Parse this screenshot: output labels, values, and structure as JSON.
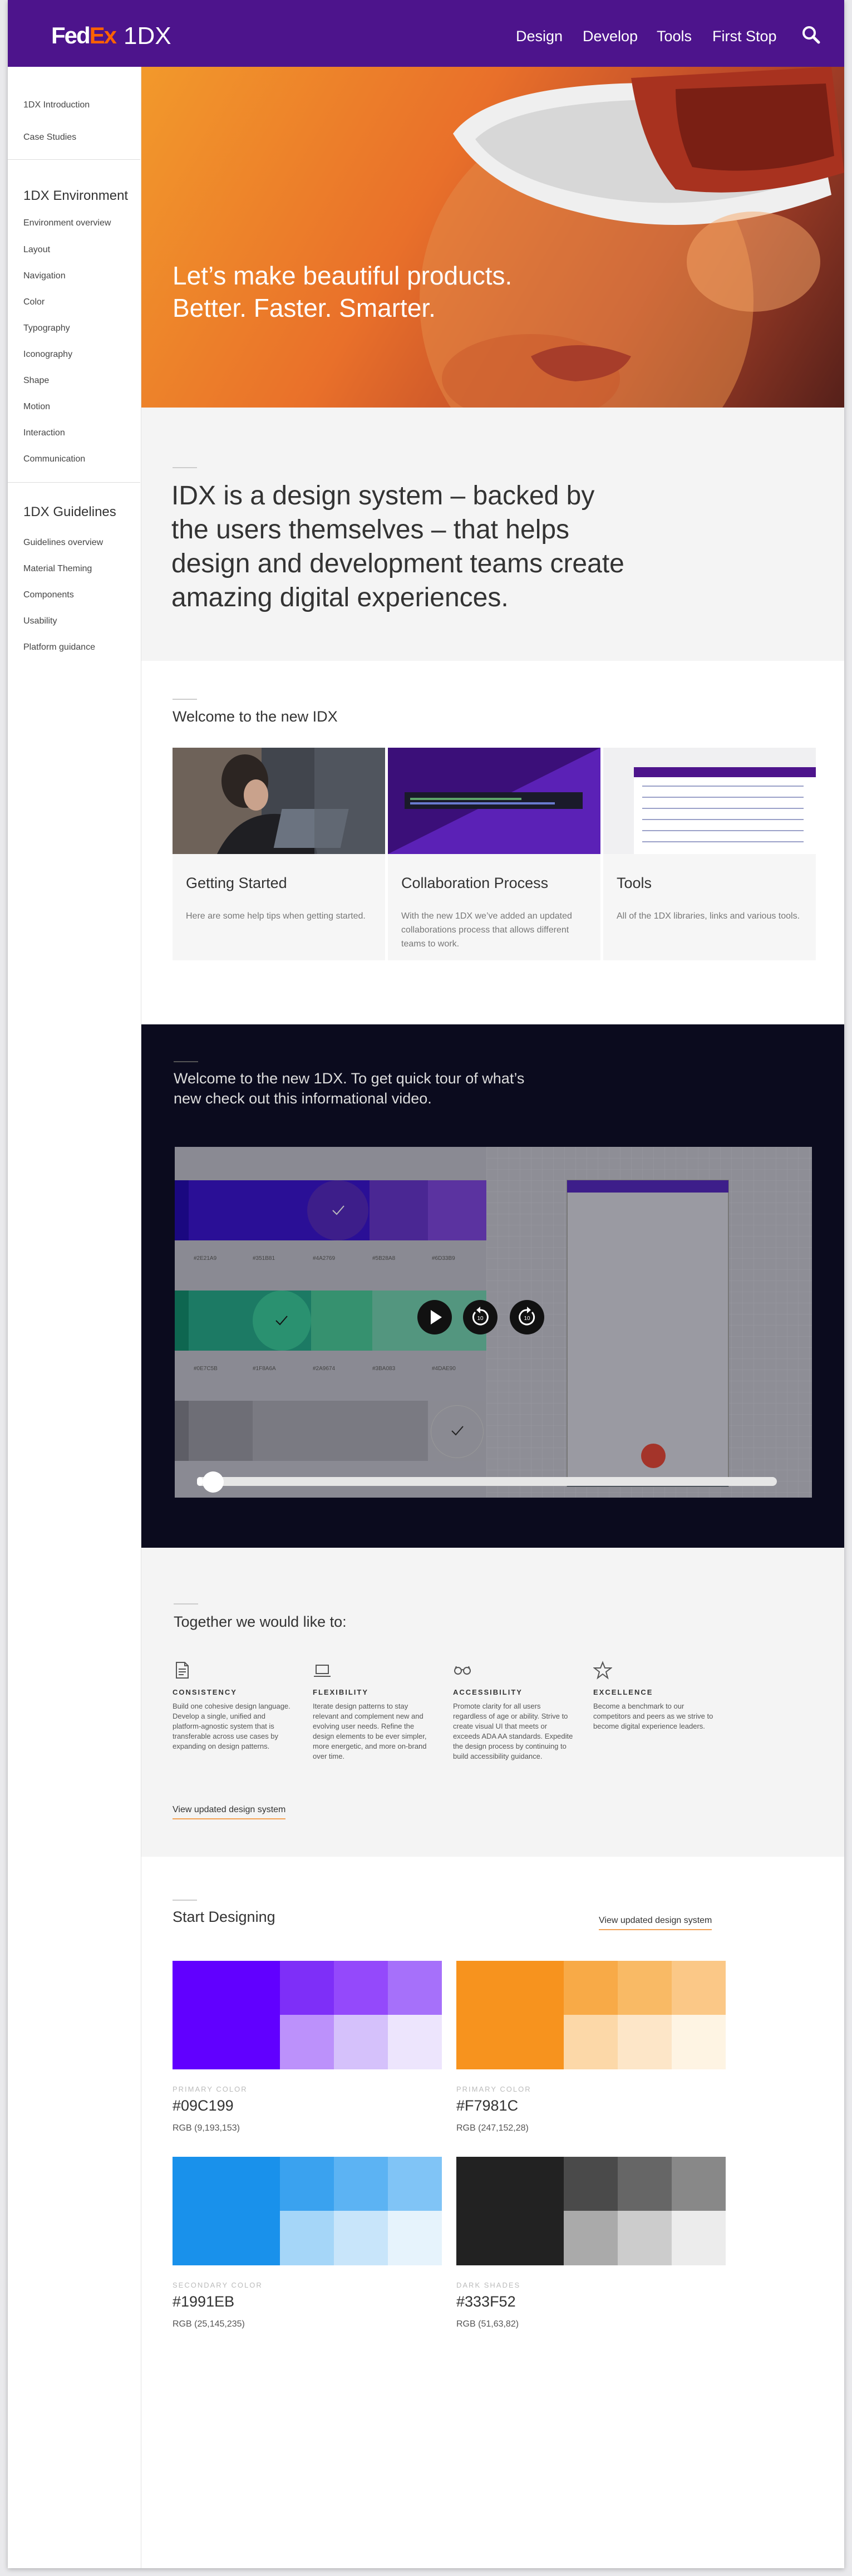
{
  "header": {
    "brand_fed": "Fed",
    "brand_ex": "Ex",
    "product": "1DX",
    "nav": [
      "Design",
      "Develop",
      "Tools",
      "First Stop"
    ],
    "search_icon": "search-icon"
  },
  "sidebar": {
    "top_items": [
      "1DX Introduction",
      "Case Studies"
    ],
    "environment_heading": "1DX Environment",
    "environment_items": [
      "Environment overview",
      "Layout",
      "Navigation",
      "Color",
      "Typography",
      "Iconography",
      "Shape",
      "Motion",
      "Interaction",
      "Communication"
    ],
    "guidelines_heading": "1DX Guidelines",
    "guidelines_items": [
      "Guidelines overview",
      "Material Theming",
      "Components",
      "Usability",
      "Platform guidance"
    ]
  },
  "hero": {
    "line1": "Let’s make beautiful products.",
    "line2": "Better. Faster. Smarter."
  },
  "intro": {
    "lines": [
      "IDX is a design system – backed by",
      "the users themselves – that helps",
      "design and development teams create",
      "amazing digital experiences."
    ]
  },
  "welcome": {
    "title": "Welcome to the new IDX",
    "cards": [
      {
        "title": "Getting Started",
        "desc": "Here are some help tips when getting started."
      },
      {
        "title": "Collaboration Process",
        "desc": "With the new 1DX we’ve added an updated collaborations process that allows different teams to work."
      },
      {
        "title": "Tools",
        "desc": "All of the 1DX libraries, links and various tools."
      }
    ]
  },
  "video": {
    "line1": "Welcome to the new 1DX. To get quick tour of what’s",
    "line2": "new check out this informational video.",
    "purple_labels": [
      "#2E21A9",
      "#351B81",
      "#4A2769",
      "#5B28A8",
      "#6D33B9"
    ],
    "green_labels": [
      "#0E7C5B",
      "#1F8A6A",
      "#2A9674",
      "#3BA083",
      "#4DAE90"
    ],
    "controls": {
      "play": "play-icon",
      "rewind": "rewind-10-icon",
      "forward": "forward-10-icon"
    },
    "progress": 0.01
  },
  "together": {
    "title": "Together we would like to:",
    "values": [
      {
        "icon": "document-icon",
        "title": "CONSISTENCY",
        "desc": "Build one cohesive design language. Develop a single, unified and platform-agnostic system that is transferable across use cases by expanding on design patterns."
      },
      {
        "icon": "laptop-icon",
        "title": "FLEXIBILITY",
        "desc": "Iterate design patterns to stay relevant and complement new and evolving user needs. Refine the design elements to be ever simpler, more energetic, and more on-brand over time."
      },
      {
        "icon": "glasses-icon",
        "title": "ACCESSIBILITY",
        "desc": "Promote clarity for all users regardless of age or ability. Strive to create visual UI that meets or exceeds ADA AA standards. Expedite the design process by continuing to build accessibility guidance."
      },
      {
        "icon": "star-icon",
        "title": "EXCELLENCE",
        "desc": "Become a benchmark to our competitors and peers as we strive to become digital experience leaders."
      }
    ],
    "link": "View updated design system"
  },
  "start": {
    "title": "Start Designing",
    "link": "View updated design system",
    "palettes": [
      {
        "label": "PRIMARY COLOR",
        "hex": "#09C199",
        "rgb": "RGB (9,193,153)",
        "main": "#6100ff",
        "shades": [
          "#7e2ff8",
          "#9449fb",
          "#a670fa",
          "#bc91fb",
          "#d5c1fb",
          "#ede5fd"
        ]
      },
      {
        "label": "PRIMARY COLOR",
        "hex": "#F7981C",
        "rgb": "RGB (247,152,28)",
        "main": "#f7931e",
        "shades": [
          "#f8aa47",
          "#f9ba65",
          "#fbc887",
          "#fcd8a8",
          "#fde6c8",
          "#fef4e3"
        ]
      },
      {
        "label": "SECONDARY COLOR",
        "hex": "#1991EB",
        "rgb": "RGB (25,145,235)",
        "main": "#1991eb",
        "shades": [
          "#3aa2ef",
          "#5cb3f3",
          "#80c4f6",
          "#a5d6f8",
          "#c8e5fa",
          "#e6f3fc"
        ]
      },
      {
        "label": "DARK SHADES",
        "hex": "#333F52",
        "rgb": "RGB (51,63,82)",
        "main": "#222222",
        "shades": [
          "#4a4a4a",
          "#666666",
          "#888888",
          "#aaaaaa",
          "#cccccc",
          "#ececec"
        ]
      }
    ]
  }
}
